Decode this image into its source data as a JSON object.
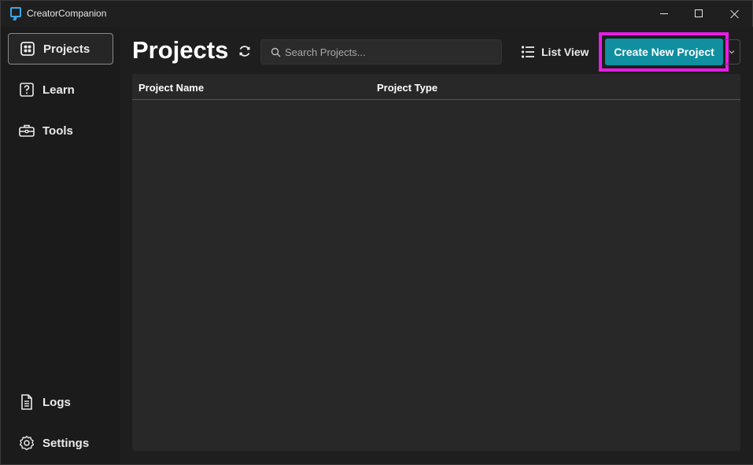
{
  "window": {
    "title": "CreatorCompanion",
    "icon": "creator-companion-icon",
    "controls": [
      "minimize-icon",
      "maximize-icon",
      "close-icon"
    ]
  },
  "sidebar": {
    "items": [
      {
        "label": "Projects",
        "icon": "projects-grid-icon",
        "active": true
      },
      {
        "label": "Learn",
        "icon": "question-icon",
        "active": false
      },
      {
        "label": "Tools",
        "icon": "toolbox-icon",
        "active": false
      },
      {
        "label": "Logs",
        "icon": "document-icon",
        "active": false
      },
      {
        "label": "Settings",
        "icon": "gear-icon",
        "active": false
      }
    ]
  },
  "header": {
    "title": "Projects",
    "refresh_icon": "refresh-icon",
    "search": {
      "placeholder": "Search Projects...",
      "value": ""
    },
    "view_toggle": {
      "label": "List View",
      "icon": "list-view-icon"
    },
    "create_button": {
      "label": "Create New Project"
    },
    "dropdown_icon": "chevron-down-icon"
  },
  "table": {
    "columns": [
      "Project Name",
      "Project Type"
    ],
    "rows": []
  },
  "colors": {
    "accent": "#0f8fa0",
    "highlight": "#e81ce8",
    "background": "#1e1e1e",
    "panel": "#282828"
  }
}
